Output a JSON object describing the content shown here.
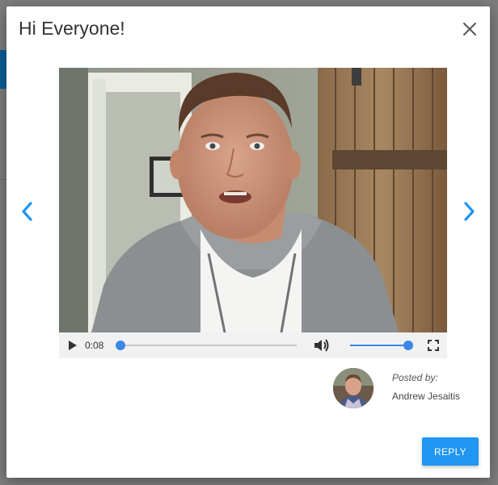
{
  "dialog": {
    "title": "Hi Everyone!",
    "close_icon": "close-icon",
    "prev_icon": "chevron-left-icon",
    "next_icon": "chevron-right-icon",
    "accent_color": "#2196f3"
  },
  "video": {
    "current_time": "0:08",
    "progress": 0.0,
    "volume": 1.0,
    "icons": {
      "play": "play-icon",
      "volume": "volume-icon",
      "fullscreen": "fullscreen-icon"
    }
  },
  "post": {
    "posted_by_label": "Posted by:",
    "author": "Andrew Jesaitis"
  },
  "actions": {
    "reply_label": "REPLY"
  }
}
